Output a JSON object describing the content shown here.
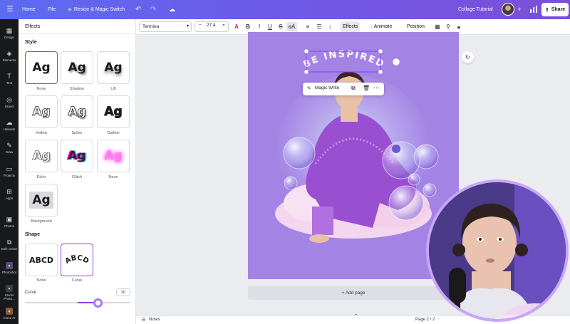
{
  "topbar": {
    "home": "Home",
    "file": "File",
    "resize": "Resize & Magic Switch",
    "doc_title": "Collage Tutorial",
    "share": "Share"
  },
  "rail": [
    {
      "label": "Design",
      "icon": "design-icon"
    },
    {
      "label": "Elements",
      "icon": "elements-icon"
    },
    {
      "label": "Text",
      "icon": "text-icon"
    },
    {
      "label": "Brand",
      "icon": "brand-icon"
    },
    {
      "label": "Uploads",
      "icon": "uploads-icon"
    },
    {
      "label": "Draw",
      "icon": "draw-icon"
    },
    {
      "label": "Projects",
      "icon": "projects-icon"
    },
    {
      "label": "Apps",
      "icon": "apps-icon"
    },
    {
      "label": "Photos",
      "icon": "photos-icon"
    },
    {
      "label": "Bulk create",
      "icon": "bulk-create-icon"
    },
    {
      "label": "Photoshot",
      "icon": "photoshot-icon"
    },
    {
      "label": "Studio Photo...",
      "icon": "studio-photo-icon"
    },
    {
      "label": "Clone AI",
      "icon": "clone-icon"
    }
  ],
  "panel": {
    "title": "Effects",
    "style_label": "Style",
    "styles": [
      {
        "caption": "None",
        "sample": "Ag"
      },
      {
        "caption": "Shadow",
        "sample": "Ag"
      },
      {
        "caption": "Lift",
        "sample": "Ag"
      },
      {
        "caption": "Hollow",
        "sample": "Ag"
      },
      {
        "caption": "Splice",
        "sample": "Ag"
      },
      {
        "caption": "Outline",
        "sample": "Ag"
      },
      {
        "caption": "Echo",
        "sample": "Ag"
      },
      {
        "caption": "Glitch",
        "sample": "Ag"
      },
      {
        "caption": "Neon",
        "sample": "Ag"
      },
      {
        "caption": "Background",
        "sample": "Ag"
      }
    ],
    "shape_label": "Shape",
    "shapes": [
      {
        "caption": "None",
        "sample": "ABCD"
      },
      {
        "caption": "Curve",
        "sample": "ABCD"
      }
    ],
    "curve_label": "Curve",
    "curve_value": "20"
  },
  "toolbar": {
    "font": "Termina",
    "size": "27.4",
    "minus": "−",
    "plus": "+",
    "bold": "B",
    "italic": "I",
    "underline": "U",
    "strike": "S",
    "case": "aA",
    "effects": "Effects",
    "animate": "Animate",
    "position": "Position"
  },
  "canvas": {
    "headline": "BE INSPIRED",
    "magic_write": "Magic Write",
    "add_page": "+ Add page"
  },
  "footer": {
    "notes": "Notes",
    "pages": "Page 2 / 2"
  },
  "colors": {
    "accent": "#8b3dff",
    "canvas_bg": "#a383e4",
    "topbar_start": "#5b6cf0",
    "topbar_end": "#7b4fd8"
  }
}
